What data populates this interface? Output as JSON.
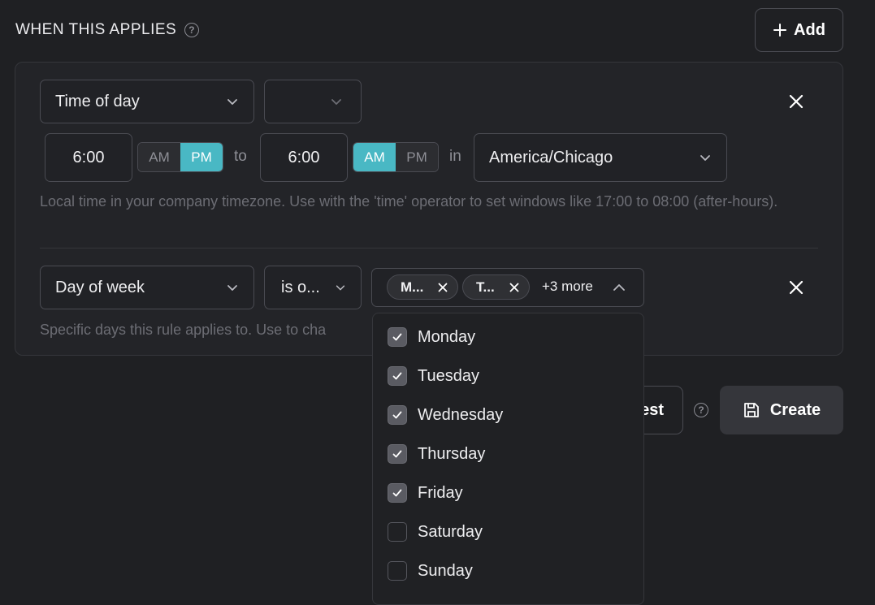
{
  "section": {
    "title": "WHEN THIS APPLIES",
    "help_glyph": "?"
  },
  "add_button": {
    "label": "Add",
    "icon": "plus-icon"
  },
  "rule_time": {
    "field": "Time of day",
    "operator": "",
    "start_time": "6:00",
    "start_ampm": {
      "am": "AM",
      "pm": "PM",
      "selected": "PM"
    },
    "to_label": "to",
    "end_time": "6:00",
    "end_ampm": {
      "am": "AM",
      "pm": "PM",
      "selected": "AM"
    },
    "in_label": "in",
    "timezone": "America/Chicago",
    "hint": "Local time in your company timezone. Use with the 'time' operator to set windows like 17:00 to 08:00 (after-hours)."
  },
  "rule_day": {
    "field": "Day of week",
    "operator": "is o...",
    "chips": [
      {
        "label": "M..."
      },
      {
        "label": "T..."
      }
    ],
    "more": "+3 more",
    "hint": "Specific days this rule applies to. Use to cha"
  },
  "dropdown": {
    "options": [
      {
        "label": "Monday",
        "checked": true
      },
      {
        "label": "Tuesday",
        "checked": true
      },
      {
        "label": "Wednesday",
        "checked": true
      },
      {
        "label": "Thursday",
        "checked": true
      },
      {
        "label": "Friday",
        "checked": true
      },
      {
        "label": "Saturday",
        "checked": false
      },
      {
        "label": "Sunday",
        "checked": false
      }
    ]
  },
  "footer": {
    "test_label": "est",
    "help_glyph": "?",
    "create_label": "Create"
  },
  "colors": {
    "accent": "#49b8c4",
    "background": "#1f2023",
    "panel": "#232428"
  }
}
